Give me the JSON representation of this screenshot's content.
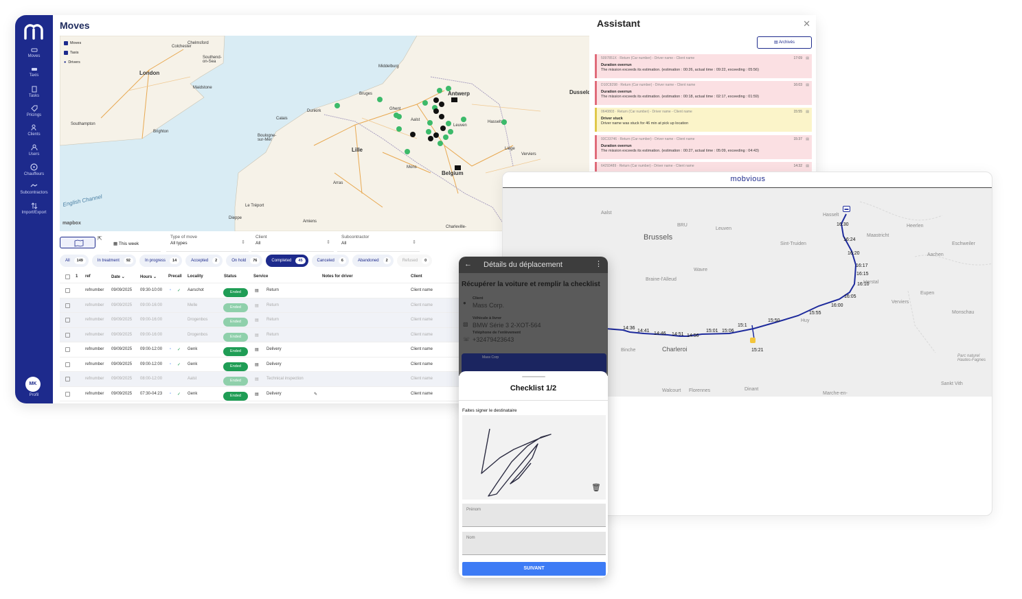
{
  "sidebar": {
    "items": [
      {
        "label": "Moves",
        "icon": "car-icon"
      },
      {
        "label": "Taxis",
        "icon": "taxi-icon"
      },
      {
        "label": "Tasks",
        "icon": "clipboard-icon"
      },
      {
        "label": "Pricings",
        "icon": "tag-icon"
      },
      {
        "label": "Clients",
        "icon": "clients-icon"
      },
      {
        "label": "Users",
        "icon": "users-icon"
      },
      {
        "label": "Chauffeurs",
        "icon": "steering-wheel-icon"
      },
      {
        "label": "Subcontractors",
        "icon": "handshake-icon"
      },
      {
        "label": "Import/Export",
        "icon": "import-export-icon"
      }
    ],
    "avatar": "MK",
    "profile": "Profil"
  },
  "page": {
    "title": "Moves"
  },
  "map": {
    "legend": [
      "Moves",
      "Taxis",
      "Drivers"
    ],
    "labels": {
      "chelmsford": "Chelmsford",
      "southend": "Southend-\non-Sea",
      "london": "London",
      "middelburg": "Middelburg",
      "antwerp": "Antwerp",
      "dusseld": "Dusseld",
      "bruges": "Bruges",
      "ghent": "Ghent",
      "dunkirk": "Dunkirk",
      "aalst": "Aalst",
      "calais": "Calais",
      "southampton": "Southampton",
      "brighton": "Brighton",
      "boulogne": "Boulogne-\nsur-Mer",
      "lille": "Lille",
      "hasselt": "Hasselt",
      "liege": "Liège",
      "mons": "Mons",
      "belgium": "Belgium",
      "arras": "Arras",
      "amiens": "Amiens",
      "dieppe": "Dieppe",
      "letreport": "Le Tréport",
      "charleville": "Charleville-",
      "maidstone": "Maidstone",
      "leuven": "Leuven",
      "colchester": "Colchester",
      "verviers": "Verviers"
    },
    "sea": "English Channel",
    "attribution": "mapbox"
  },
  "filters": {
    "week": "This week",
    "type_label": "Type of move",
    "type_value": "All types",
    "client_label": "Client",
    "client_value": "All",
    "sub_label": "Subcontractor",
    "sub_value": "All"
  },
  "tabs": [
    {
      "label": "All",
      "count": "149"
    },
    {
      "label": "In treatment",
      "count": "92"
    },
    {
      "label": "In progress",
      "count": "14"
    },
    {
      "label": "Accepted",
      "count": "2"
    },
    {
      "label": "On hold",
      "count": "76"
    },
    {
      "label": "Completed",
      "count": "45"
    },
    {
      "label": "Canceled",
      "count": "6"
    },
    {
      "label": "Abandoned",
      "count": "2"
    },
    {
      "label": "Refused",
      "count": "0"
    }
  ],
  "table": {
    "headers": {
      "selected": "1",
      "ref": "ref",
      "date": "Date",
      "hours": "Hours",
      "precall": "Precall",
      "locality": "Locality",
      "status": "Status",
      "service": "Service",
      "notes": "Notes for driver",
      "client": "Client"
    },
    "rows": [
      {
        "ref": "refnumber",
        "date": "09/09/2025",
        "hours": "09:30-10:00",
        "locality": "Aarschot",
        "status": "Ended",
        "service": "Return",
        "client": "Client name"
      },
      {
        "ref": "refnumber",
        "date": "09/09/2025",
        "hours": "09:00-16:00",
        "locality": "Melle",
        "status": "Ended",
        "service": "Return",
        "client": "Client name"
      },
      {
        "ref": "refnumber",
        "date": "09/09/2025",
        "hours": "09:00-16:00",
        "locality": "Drogenbos",
        "status": "Ended",
        "service": "Return",
        "client": "Client name"
      },
      {
        "ref": "refnumber",
        "date": "09/09/2025",
        "hours": "09:00-16:00",
        "locality": "Drogenbos",
        "status": "Ended",
        "service": "Return",
        "client": "Client name"
      },
      {
        "ref": "refnumber",
        "date": "09/09/2025",
        "hours": "09:00-12:00",
        "locality": "Genk",
        "status": "Ended",
        "service": "Delivery",
        "client": "Client name"
      },
      {
        "ref": "refnumber",
        "date": "09/09/2025",
        "hours": "09:00-12:00",
        "locality": "Genk",
        "status": "Ended",
        "service": "Delivery",
        "client": "Client name"
      },
      {
        "ref": "refnumber",
        "date": "09/09/2025",
        "hours": "08:00-12:00",
        "locality": "Aalst",
        "status": "Ended",
        "service": "Technical inspection",
        "client": "Client name"
      },
      {
        "ref": "refnumber",
        "date": "09/09/2025",
        "hours": "07:30-04:23",
        "locality": "Genk",
        "status": "Ended",
        "service": "Delivery",
        "client": "Client name"
      }
    ]
  },
  "assistant": {
    "title": "Assistant",
    "archives": "Archivés",
    "alerts": [
      {
        "meta": "5097851X  ·  Return  (Car number) - Driver name - Client name",
        "title": "Duration overrun",
        "msg": "The mission exceeds its estimation. (estimation : 00:26, actual time : 09:22, exceeding : 05:56)",
        "time": "17:09"
      },
      {
        "meta": "D10C8298  ·  Return  (Car number) - Driver name - Client name",
        "title": "Duration overrun",
        "msg": "The mission exceeds its estimation. (estimation : 00:18, actual time : 02:17, exceeding : 01:59)",
        "time": "16:03"
      },
      {
        "meta": "0640803  ·  Return  (Car number) - Driver name - Client name",
        "title": "Driver stuck",
        "msg": "Driver name was stuck for 46 min at pick up location",
        "time": "15:55"
      },
      {
        "meta": "93C33746  ·  Return  (Car number) - Driver name - Client name",
        "title": "Duration overrun",
        "msg": "The mission exceeds its estimation. (estimation : 00:27, actual time : 05:09, exceeding : 04:43)",
        "time": "15:37"
      },
      {
        "meta": "64293489  ·  Return  (Car number) - Driver name - Client name",
        "title": "",
        "msg": "",
        "time": "14:32"
      }
    ]
  },
  "tracking": {
    "brand": "mobvious",
    "labels": {
      "brussels": "Brussels",
      "aalst": "Aalst",
      "bru": "BRU",
      "leuven": "Leuven",
      "hasselt": "Hasselt",
      "heerlen": "Heerlen",
      "maastricht": "Maastricht",
      "eschweiler": "Eschweiler",
      "sinttruiden": "Sint-Truiden",
      "aachen": "Aachen",
      "wavre": "Wavre",
      "braine": "Braine-l'Alleud",
      "herstal": "Herstal",
      "verviers": "Verviers",
      "eupen": "Eupen",
      "huy": "Huy",
      "monschau": "Monschau",
      "binche": "Binche",
      "charleroi": "Charleroi",
      "parc": "Parc naturel\nHautes-Fagnes",
      "walcourt": "Walcourt",
      "florennes": "Florennes",
      "dinant": "Dinant",
      "sankt": "Sankt Vith",
      "marche": "Marche-en-"
    },
    "times": [
      "16:30",
      "16:24",
      "16:20",
      "16:17",
      "16:15",
      "16:10",
      "16:05",
      "16:00",
      "15:55",
      "15:50",
      "15:1",
      "15:21",
      "15:06",
      "15:01",
      "14:56",
      "14:51",
      "14:46",
      "14:41",
      "14:36"
    ]
  },
  "phone": {
    "header": "Détails du déplacement",
    "task": "Récupérer la voiture et remplir la checklist",
    "client_label": "Client",
    "client_value": "Mass Corp.",
    "vehicle_label": "Véhicule à livrer",
    "vehicle_value": "BMW Série 3 2-XOT-564",
    "phone_label": "Téléphone de l'enlèvement",
    "phone_value": "+32479423643",
    "card_text": "Mass Corp",
    "checklist_title": "Checklist 1/2",
    "sign_label": "Faites signer le destinataire",
    "first_name": "Prénom",
    "last_name": "Nom",
    "next": "SUIVANT"
  }
}
